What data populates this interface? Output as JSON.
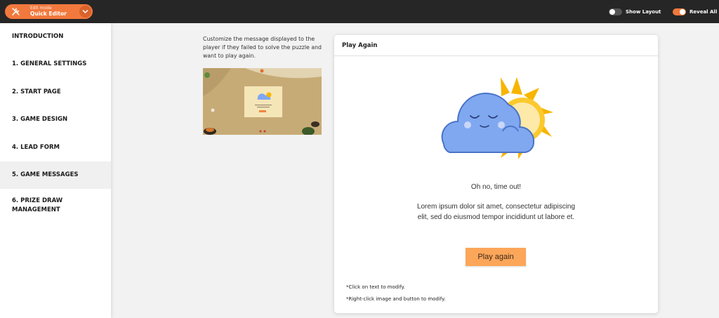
{
  "topbar": {
    "edit_mode_label": "Edit mode",
    "edit_mode_value": "Quick Editor",
    "show_layout_label": "Show Layout",
    "show_layout_on": false,
    "reveal_all_label": "Reveal All",
    "reveal_all_on": true
  },
  "sidebar": {
    "items": [
      {
        "label": "INTRODUCTION",
        "active": false
      },
      {
        "label": "1. GENERAL SETTINGS",
        "active": false
      },
      {
        "label": "2. START PAGE",
        "active": false
      },
      {
        "label": "3. GAME DESIGN",
        "active": false
      },
      {
        "label": "4. LEAD FORM",
        "active": false
      },
      {
        "label": "5. GAME MESSAGES",
        "active": true
      },
      {
        "label": "6. PRIZE DRAW MANAGEMENT",
        "active": false
      }
    ]
  },
  "main": {
    "description": "Customize the message displayed to the player if they failed to solve the puzzle and want to play again.",
    "card": {
      "title": "Play Again",
      "message_title": "Oh no, time out!",
      "message_body": "Lorem ipsum dolor sit amet, consectetur adipiscing elit, sed do eiusmod tempor incididunt ut labore et.",
      "button_label": "Play again",
      "note_text": "*Click on text to modify.",
      "note_image": "*Right-click image and button to modify."
    }
  },
  "colors": {
    "accent": "#f2793d",
    "button": "#fca65a",
    "cloud": "#80a8f0",
    "sun": "#f7b500"
  }
}
